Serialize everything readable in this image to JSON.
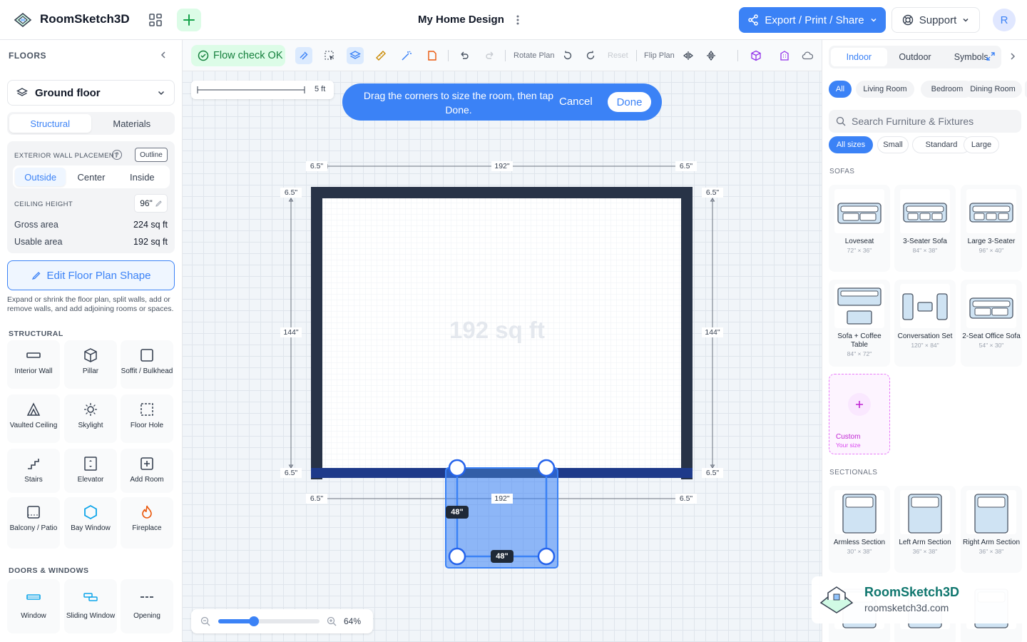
{
  "header": {
    "app_name": "RoomSketch3D",
    "doc_title": "My Home Design",
    "export_label": "Export / Print / Share",
    "support_label": "Support",
    "avatar_initial": "R"
  },
  "left": {
    "floors_title": "FLOORS",
    "floor_name": "Ground floor",
    "tabs": [
      "Structural",
      "Materials"
    ],
    "wall_placement_label": "EXTERIOR WALL PLACEMENT",
    "outline_label": "Outline",
    "placement_options": [
      "Outside",
      "Center",
      "Inside"
    ],
    "ceiling_label": "CEILING HEIGHT",
    "ceiling_value": "96\"",
    "gross_label": "Gross area",
    "gross_value": "224 sq ft",
    "usable_label": "Usable area",
    "usable_value": "192 sq ft",
    "edit_button": "Edit Floor Plan Shape",
    "help": "Expand or shrink the floor plan, split walls, add or remove walls, and add adjoining rooms or spaces.",
    "structural_title": "STRUCTURAL",
    "structural_items": [
      "Interior Wall",
      "Pillar",
      "Soffit / Bulkhead",
      "Vaulted Ceiling",
      "Skylight",
      "Floor Hole",
      "Stairs",
      "Elevator",
      "Add Room",
      "Balcony / Patio",
      "Bay Window",
      "Fireplace"
    ],
    "doors_title": "DOORS & WINDOWS",
    "door_items": [
      "Window",
      "Sliding Window",
      "Opening"
    ]
  },
  "toolbar": {
    "flow_check": "Flow check OK",
    "rotate_label": "Rotate Plan",
    "reset_label": "Reset",
    "flip_label": "Flip Plan"
  },
  "canvas": {
    "scale_label": "5 ft",
    "hint": "Drag the corners to size the room, then tap Done.",
    "cancel": "Cancel",
    "done": "Done",
    "area_watermark": "192 sq ft",
    "dims": {
      "top_left": "6.5\"",
      "top_mid": "192\"",
      "top_right": "6.5\"",
      "left_top": "6.5\"",
      "right_top": "6.5\"",
      "left_mid": "144\"",
      "right_mid": "144\"",
      "left_bot": "6.5\"",
      "right_bot": "6.5\"",
      "bot_left": "6.5\"",
      "bot_mid": "192\"",
      "bot_right": "6.5\"",
      "new_side": "48\"",
      "new_bottom": "48\""
    },
    "zoom": "64%",
    "zoom_level": 0.35
  },
  "right": {
    "tabs": [
      "Indoor",
      "Outdoor",
      "Symbols"
    ],
    "rooms": [
      "All",
      "Living Room",
      "Bedroom",
      "Dining Room"
    ],
    "search_placeholder": "Search Furniture & Fixtures",
    "sizes": [
      "All sizes",
      "Small",
      "Standard",
      "Large"
    ],
    "sofas_title": "SOFAS",
    "sofas": [
      {
        "name": "Loveseat",
        "size": "72\" × 36\""
      },
      {
        "name": "3-Seater Sofa",
        "size": "84\" × 38\""
      },
      {
        "name": "Large 3-Seater",
        "size": "96\" × 40\""
      },
      {
        "name": "Sofa + Coffee Table",
        "size": "84\" × 72\""
      },
      {
        "name": "Conversation Set",
        "size": "120\" × 84\""
      },
      {
        "name": "2-Seat Office Sofa",
        "size": "54\" × 30\""
      }
    ],
    "custom": {
      "name": "Custom",
      "sub": "Your size"
    },
    "sectionals_title": "SECTIONALS",
    "sectionals": [
      {
        "name": "Armless Section",
        "size": "30\" × 38\""
      },
      {
        "name": "Left Arm Section",
        "size": "36\" × 38\""
      },
      {
        "name": "Right Arm Section",
        "size": "36\" × 38\""
      }
    ]
  },
  "watermark": {
    "name": "RoomSketch3D",
    "url": "roomsketch3d.com"
  },
  "colors": {
    "accent": "#3b82f6",
    "wall": "#283347",
    "ok_green": "#15803d",
    "custom_purple": "#c026d3"
  }
}
